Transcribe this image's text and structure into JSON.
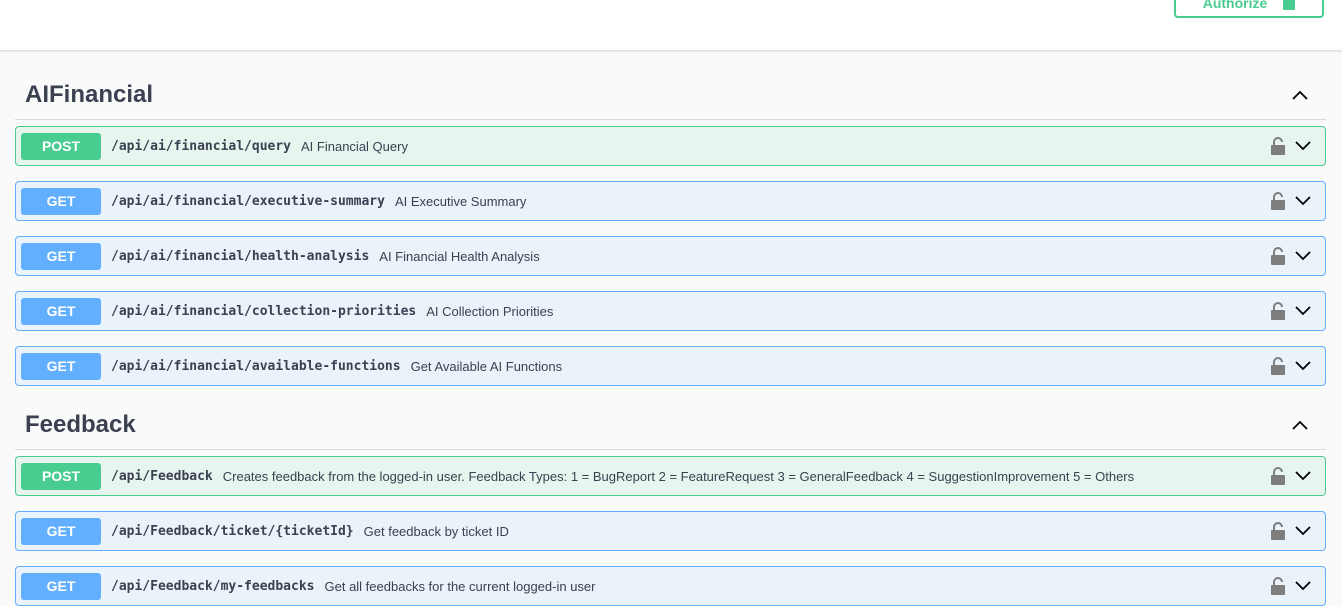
{
  "topbar": {
    "authorize_label": "Authorize"
  },
  "sections": [
    {
      "title": "AIFinancial",
      "operations": [
        {
          "method": "POST",
          "path": "/api/ai/financial/query",
          "summary": "AI Financial Query"
        },
        {
          "method": "GET",
          "path": "/api/ai/financial/executive-summary",
          "summary": "AI Executive Summary"
        },
        {
          "method": "GET",
          "path": "/api/ai/financial/health-analysis",
          "summary": "AI Financial Health Analysis"
        },
        {
          "method": "GET",
          "path": "/api/ai/financial/collection-priorities",
          "summary": "AI Collection Priorities"
        },
        {
          "method": "GET",
          "path": "/api/ai/financial/available-functions",
          "summary": "Get Available AI Functions"
        }
      ]
    },
    {
      "title": "Feedback",
      "operations": [
        {
          "method": "POST",
          "path": "/api/Feedback",
          "summary": "Creates feedback from the logged-in user. Feedback Types: 1 = BugReport 2 = FeatureRequest 3 = GeneralFeedback 4 = SuggestionImprovement 5 = Others"
        },
        {
          "method": "GET",
          "path": "/api/Feedback/ticket/{ticketId}",
          "summary": "Get feedback by ticket ID"
        },
        {
          "method": "GET",
          "path": "/api/Feedback/my-feedbacks",
          "summary": "Get all feedbacks for the current logged-in user"
        }
      ]
    }
  ],
  "colors": {
    "post": "#49cc90",
    "get": "#61affe",
    "text": "#3b4151"
  },
  "icons": {
    "lock": "lock-icon",
    "expand": "chevron-down-icon",
    "collapse": "chevron-up-icon"
  }
}
